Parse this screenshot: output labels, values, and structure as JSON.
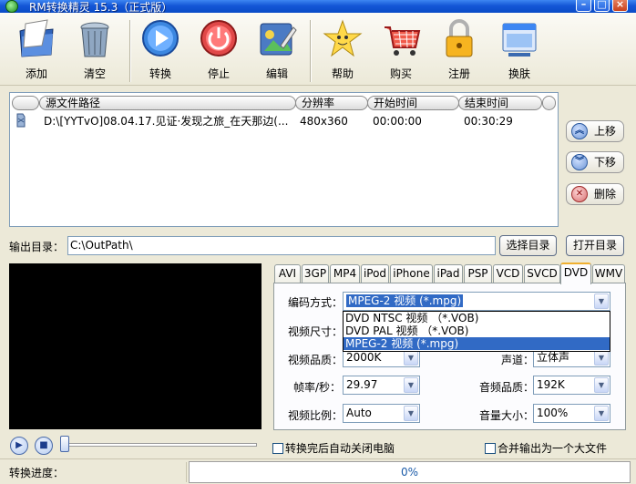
{
  "window": {
    "title": "RM转换精灵 15.3（正式版）"
  },
  "toolbar": {
    "add": "添加",
    "clear": "清空",
    "convert": "转换",
    "stop": "停止",
    "edit": "编辑",
    "help": "帮助",
    "buy": "购买",
    "register": "注册",
    "skin": "换肤"
  },
  "filelist": {
    "columns": {
      "path": "源文件路径",
      "resolution": "分辨率",
      "start": "开始时间",
      "end": "结束时间"
    },
    "rows": [
      {
        "path": "D:\\[YYTvO]08.04.17.见证·发现之旅_在天那边(...",
        "resolution": "480x360",
        "start": "00:00:00",
        "end": "00:30:29"
      }
    ]
  },
  "side": {
    "up": "上移",
    "down": "下移",
    "delete": "删除"
  },
  "output": {
    "label": "输出目录：",
    "path": "C:\\OutPath\\",
    "choose": "选择目录",
    "open": "打开目录"
  },
  "tabs": [
    "AVI",
    "3GP",
    "MP4",
    "iPod",
    "iPhone",
    "iPad",
    "PSP",
    "VCD",
    "SVCD",
    "DVD",
    "WMV"
  ],
  "active_tab": "DVD",
  "settings": {
    "codec_label": "编码方式：",
    "codec_value": "MPEG-2 视频 (*.mpg)",
    "codec_options": [
      "DVD NTSC 视频 （*.VOB)",
      "DVD PAL 视频 （*.VOB)",
      "MPEG-2 视频 (*.mpg)"
    ],
    "size_label": "视频尺寸：",
    "vquality_label": "视频品质：",
    "vquality_value": "2000K",
    "channel_label": "声道：",
    "channel_value": "立体声",
    "fps_label": "帧率/秒：",
    "fps_value": "29.97",
    "aquality_label": "音频品质：",
    "aquality_value": "192K",
    "ratio_label": "视频比例：",
    "ratio_value": "Auto",
    "volume_label": "音量大小：",
    "volume_value": "100%"
  },
  "options": {
    "shutdown": "转换完后自动关闭电脑",
    "merge": "合并输出为一个大文件"
  },
  "status": {
    "label": "转换进度：",
    "progress_text": "0%",
    "progress": 0
  }
}
